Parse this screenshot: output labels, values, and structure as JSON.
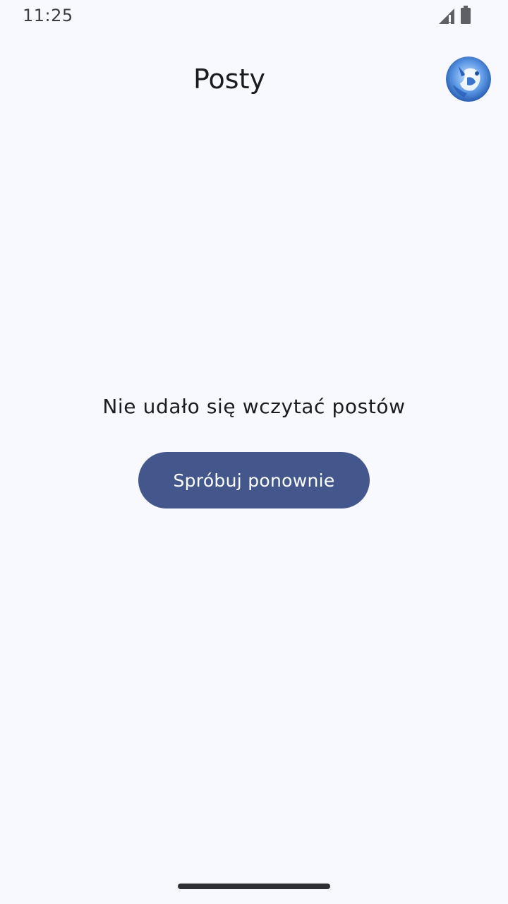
{
  "status_bar": {
    "time": "11:25",
    "icons": [
      "signal-icon",
      "battery-icon"
    ]
  },
  "app_bar": {
    "title": "Posty",
    "avatar_icon": "profile-avatar-icon"
  },
  "content": {
    "error_message": "Nie udało się wczytać postów",
    "retry_label": "Spróbuj ponownie"
  },
  "colors": {
    "background": "#f8f9ff",
    "primary": "#44578d",
    "on_primary": "#ffffff",
    "on_surface": "#1b1c20"
  }
}
